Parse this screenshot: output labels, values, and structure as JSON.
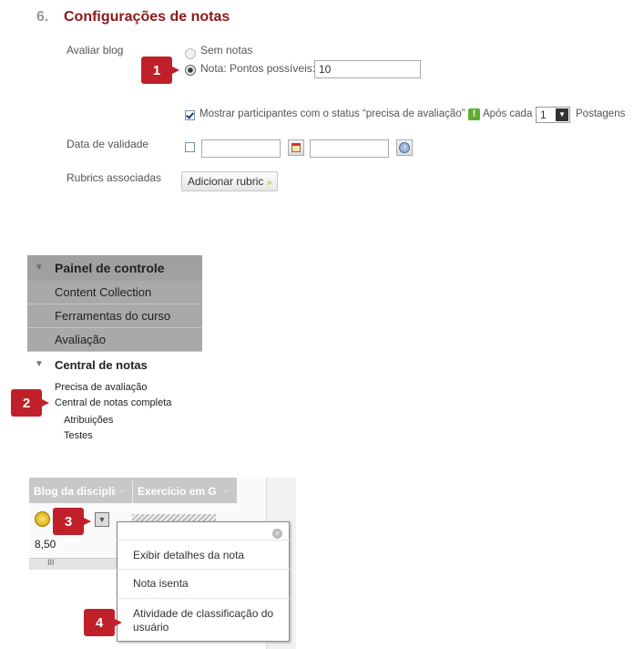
{
  "section": {
    "number": "6.",
    "title": "Configurações de notas"
  },
  "form": {
    "grade_label": "Avaliar blog",
    "no_grade": "Sem notas",
    "points_label": "Nota: Pontos possíveis:",
    "points_value": "10",
    "show_participants": "Mostrar participantes com o status “precisa de avaliação”",
    "after_each": "Após cada",
    "after_count": "1",
    "posts": "Postagens",
    "due_date_label": "Data de validade",
    "rubrics_label": "Rubrics associadas",
    "add_rubric": "Adicionar rubric"
  },
  "control_panel": {
    "title": "Painel de controle",
    "items": [
      "Content Collection",
      "Ferramentas do curso",
      "Avaliação"
    ],
    "gradebook": "Central de notas",
    "sub": [
      "Precisa de avaliação",
      "Central de notas completa"
    ],
    "subsub": [
      "Atribuições",
      "Testes"
    ]
  },
  "grid": {
    "col1": "Blog da disciplin",
    "col2": "Exercício em G",
    "score": "8,50",
    "scroll": "III"
  },
  "context_menu": {
    "items": [
      "Exibir detalhes da nota",
      "Nota isenta",
      "Atividade de classificação do usuário"
    ]
  },
  "callouts": [
    "1",
    "2",
    "3",
    "4"
  ]
}
